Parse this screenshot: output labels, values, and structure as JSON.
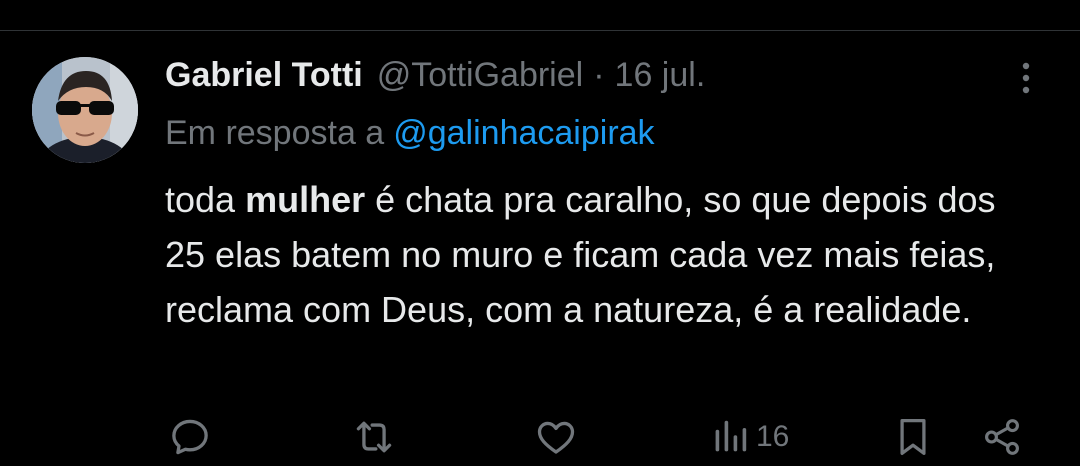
{
  "tweet": {
    "author_name": "Gabriel Totti",
    "author_handle": "@TottiGabriel",
    "separator": "·",
    "date": "16 jul.",
    "reply_prefix": "Em resposta a",
    "reply_to": "@galinhacaipirak",
    "text_before": "toda ",
    "text_bold": "mulher",
    "text_after": " é chata pra caralho, so que depois dos 25 elas batem no muro e ficam cada vez mais feias, reclama com Deus, com a natureza, é a realidade."
  },
  "actions": {
    "views_count": "16",
    "icons": [
      "reply-icon",
      "retweet-icon",
      "like-icon",
      "views-icon",
      "bookmark-icon",
      "share-icon"
    ]
  },
  "colors": {
    "background": "#000000",
    "text_primary": "#e7e9ea",
    "text_secondary": "#71767b",
    "link": "#1d9bf0",
    "divider": "#2f3336"
  },
  "icons": {
    "more": "more-options-icon",
    "avatar": "avatar"
  }
}
